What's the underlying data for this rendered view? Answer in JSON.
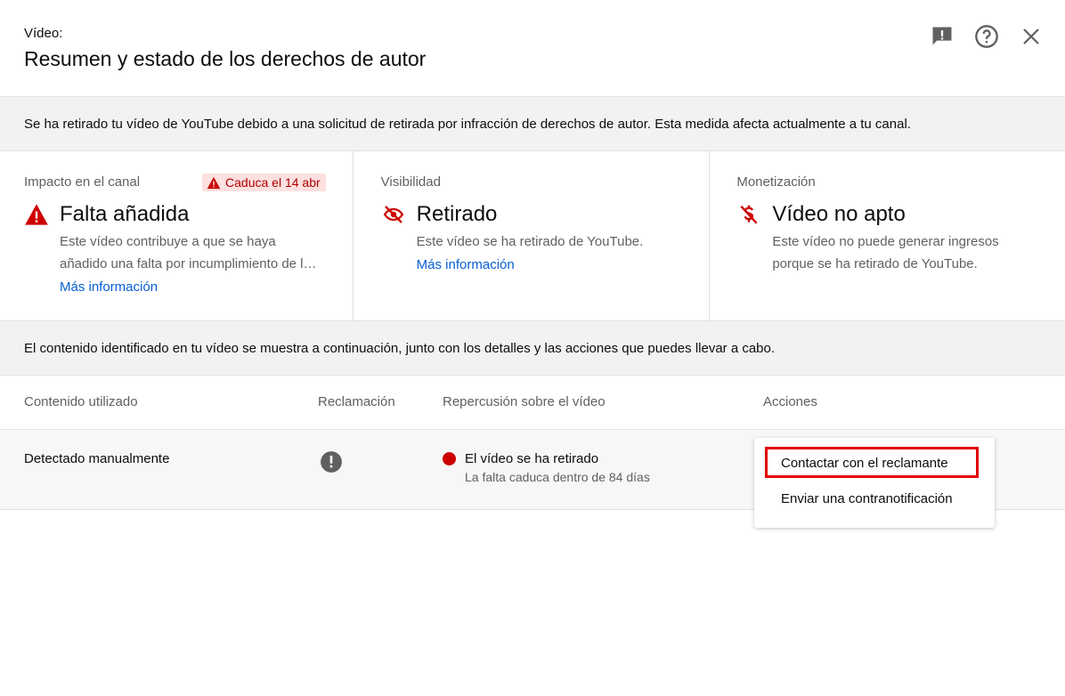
{
  "header": {
    "subtitle": "Vídeo:",
    "title": "Resumen y estado de los derechos de autor",
    "icons": [
      "feedback-icon",
      "help-icon",
      "close-icon"
    ]
  },
  "banner": {
    "text": "Se ha retirado tu vídeo de YouTube debido a una solicitud de retirada por infracción de derechos de autor. Esta medida afecta actualmente a tu canal."
  },
  "cards": {
    "impact": {
      "label": "Impacto en el canal",
      "badge": "Caduca el 14 abr",
      "status": "Falta añadida",
      "desc_line1": "Este vídeo contribuye a que se haya",
      "desc_line2": "añadido una falta por incumplimiento de las políticas de derechos de autor.",
      "link": "Más información"
    },
    "visibility": {
      "label": "Visibilidad",
      "status": "Retirado",
      "desc": "Este vídeo se ha retirado de YouTube.",
      "link": "Más información"
    },
    "monetization": {
      "label": "Monetización",
      "status": "Vídeo no apto",
      "desc_line1": "Este vídeo no puede generar ingresos",
      "desc_line2": "porque se ha retirado de YouTube."
    }
  },
  "banner2": {
    "text": "El contenido identificado en tu vídeo se muestra a continuación, junto con los detalles y las acciones que puedes llevar a cabo."
  },
  "table": {
    "headers": [
      "Contenido utilizado",
      "Reclamación",
      "Repercusión sobre el vídeo",
      "Acciones"
    ],
    "row": {
      "content": "Detectado manualmente",
      "impact_title": "El vídeo se ha retirado",
      "impact_sub": "La falta caduca dentro de 84 días"
    }
  },
  "menu": {
    "items": [
      "Contactar con el reclamante",
      "Enviar una contranotificación"
    ]
  },
  "colors": {
    "alert_red": "#cc0000",
    "link_blue": "#065fd4",
    "badge_bg": "#fde0e0",
    "highlight_red": "#e10000"
  }
}
